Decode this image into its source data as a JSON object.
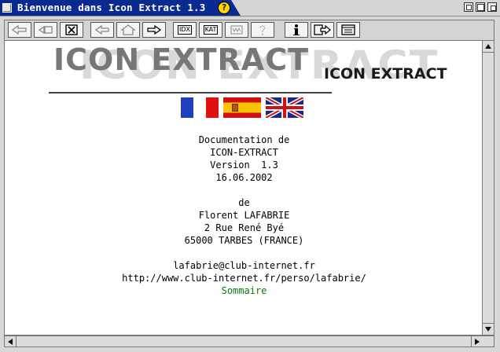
{
  "window": {
    "title": "Bienvenue dans Icon Extract 1.3",
    "help_badge": "?"
  },
  "toolbar": {
    "buttons": [
      {
        "name": "back-first",
        "label": ""
      },
      {
        "name": "back-list",
        "label": ""
      },
      {
        "name": "close-doc",
        "label": ""
      },
      {
        "name": "prev",
        "label": ""
      },
      {
        "name": "home",
        "label": ""
      },
      {
        "name": "next",
        "label": ""
      },
      {
        "name": "index",
        "label": "IDX"
      },
      {
        "name": "catalog",
        "label": "KAT"
      },
      {
        "name": "glossary",
        "label": ""
      },
      {
        "name": "help",
        "label": "?"
      },
      {
        "name": "info",
        "label": "i"
      },
      {
        "name": "export",
        "label": ""
      },
      {
        "name": "view",
        "label": ""
      }
    ]
  },
  "logo": {
    "big": "ICON EXTRACT",
    "small": "ICON EXTRACT"
  },
  "flags": [
    "France",
    "Spain",
    "United Kingdom"
  ],
  "doc": {
    "line1": "Documentation de",
    "line2": "ICON-EXTRACT",
    "line3": "Version  1.3",
    "line4": "16.06.2002",
    "line5": "de",
    "line6": "Florent LAFABRIE",
    "line7": "2 Rue René Byé",
    "line8": "65000 TARBES (FRANCE)",
    "email": "lafabrie@club-internet.fr",
    "url": "http://www.club-internet.fr/perso/lafabrie/",
    "sommaire": "Sommaire"
  },
  "colors": {
    "title_bar": "#0a2a90",
    "link_green": "#0a7a0a"
  }
}
